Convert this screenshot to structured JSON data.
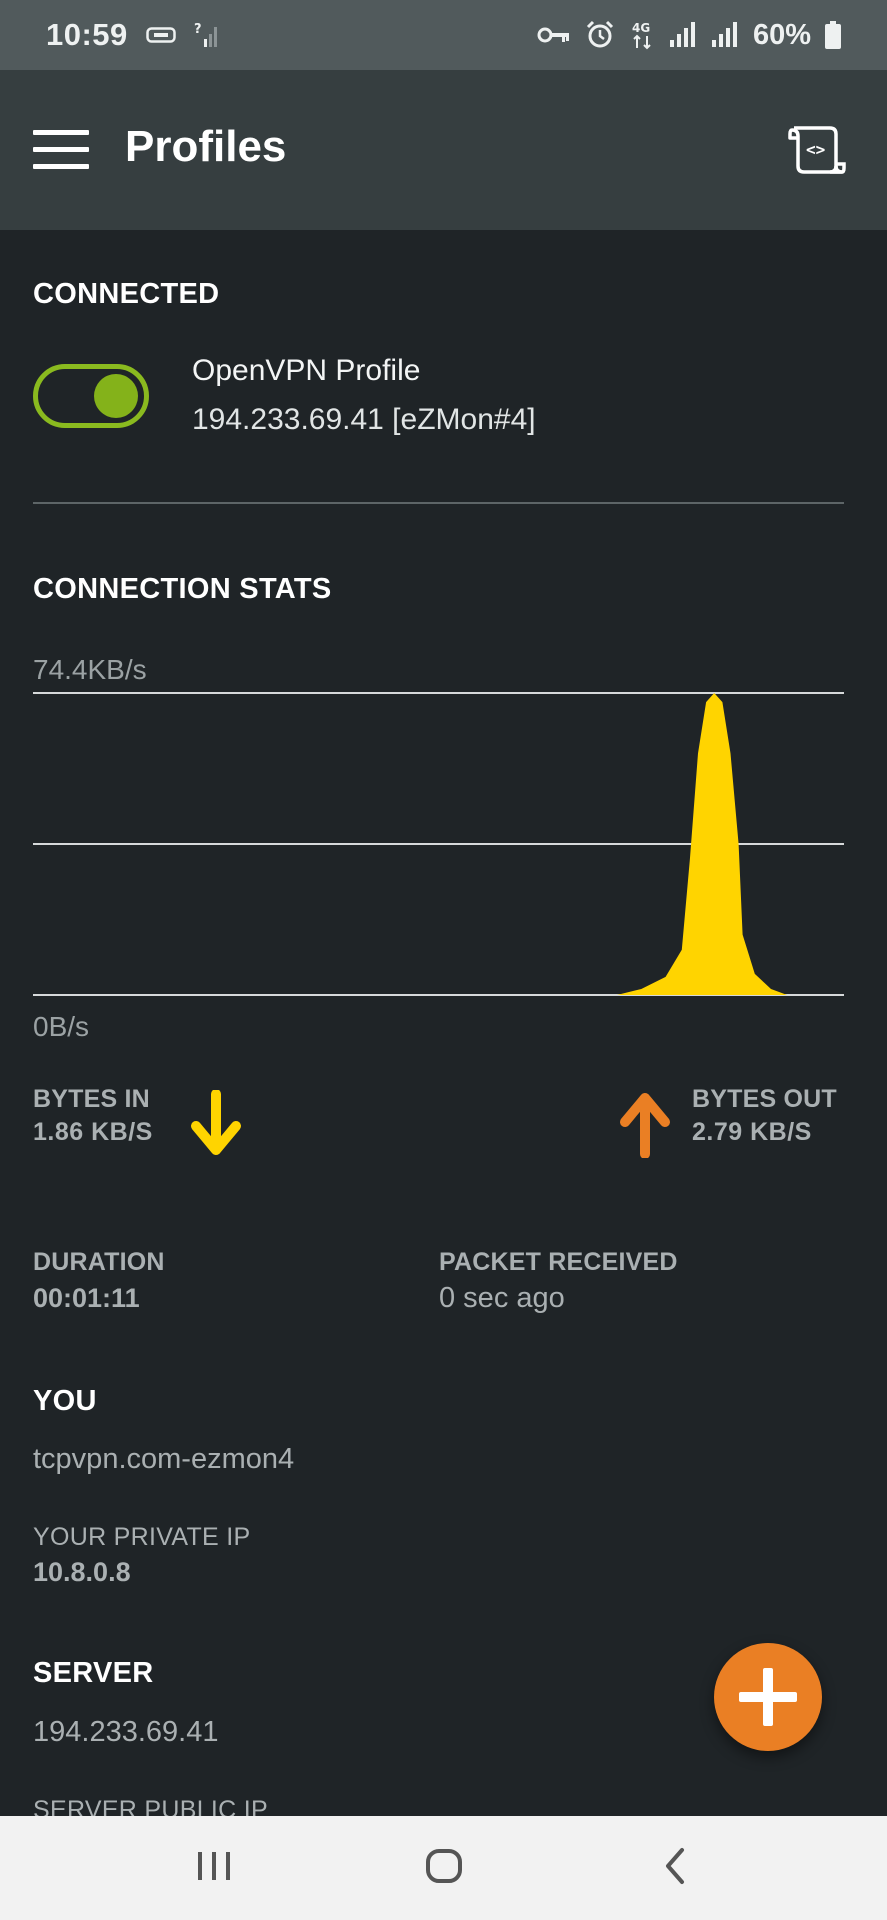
{
  "status_bar": {
    "time": "10:59",
    "battery_text": "60%",
    "icons": [
      "hd-voice-icon",
      "no-signal-icon",
      "vpn-key-icon",
      "alarm-icon",
      "4g-icon",
      "signal-icon",
      "signal-icon",
      "battery-icon"
    ]
  },
  "app_bar": {
    "title": "Profiles",
    "menu_icon": "hamburger-menu-icon",
    "log_icon": "log-scroll-icon"
  },
  "connected": {
    "section_title": "CONNECTED",
    "toggle_on": true,
    "profile_name": "OpenVPN Profile",
    "profile_address": "194.233.69.41 [eZMon#4]"
  },
  "stats": {
    "section_title": "CONNECTION STATS",
    "max_label": "74.4KB/s",
    "min_label": "0B/s",
    "bytes_in_label": "BYTES IN",
    "bytes_in_value": "1.86 KB/S",
    "bytes_out_label": "BYTES OUT",
    "bytes_out_value": "2.79 KB/S",
    "duration_label": "DURATION",
    "duration_value": "00:01:11",
    "packet_label": "PACKET RECEIVED",
    "packet_value": "0 sec ago"
  },
  "chart_data": {
    "type": "area",
    "series": [
      {
        "color": "#ffd400",
        "points": [
          [
            0,
            0
          ],
          [
            0.72,
            0
          ],
          [
            0.75,
            0.02
          ],
          [
            0.78,
            0.06
          ],
          [
            0.8,
            0.15
          ],
          [
            0.81,
            0.45
          ],
          [
            0.82,
            0.8
          ],
          [
            0.83,
            0.97
          ],
          [
            0.84,
            1.0
          ],
          [
            0.85,
            0.97
          ],
          [
            0.86,
            0.8
          ],
          [
            0.87,
            0.5
          ],
          [
            0.875,
            0.2
          ],
          [
            0.89,
            0.07
          ],
          [
            0.91,
            0.02
          ],
          [
            0.93,
            0
          ],
          [
            1.0,
            0
          ]
        ]
      }
    ],
    "ylabel_top": "74.4KB/s",
    "ylabel_bottom": "0B/s",
    "grid": true
  },
  "you": {
    "section_title": "YOU",
    "name": "tcpvpn.com-ezmon4",
    "private_ip_label": "YOUR PRIVATE IP",
    "private_ip": "10.8.0.8"
  },
  "server": {
    "section_title": "SERVER",
    "address": "194.233.69.41",
    "public_ip_label": "SERVER PUBLIC IP"
  },
  "fab_icon": "add-icon",
  "nav": {
    "recents_icon": "recents-icon",
    "home_icon": "home-icon",
    "back_icon": "back-icon"
  },
  "colors": {
    "background": "#1f2427",
    "app_bar": "#363e40",
    "status_bar": "#515a5c",
    "accent_green": "#8aba1f",
    "bytes_in": "#ffd400",
    "bytes_out": "#ea7f24",
    "fab": "#ea7f24"
  }
}
